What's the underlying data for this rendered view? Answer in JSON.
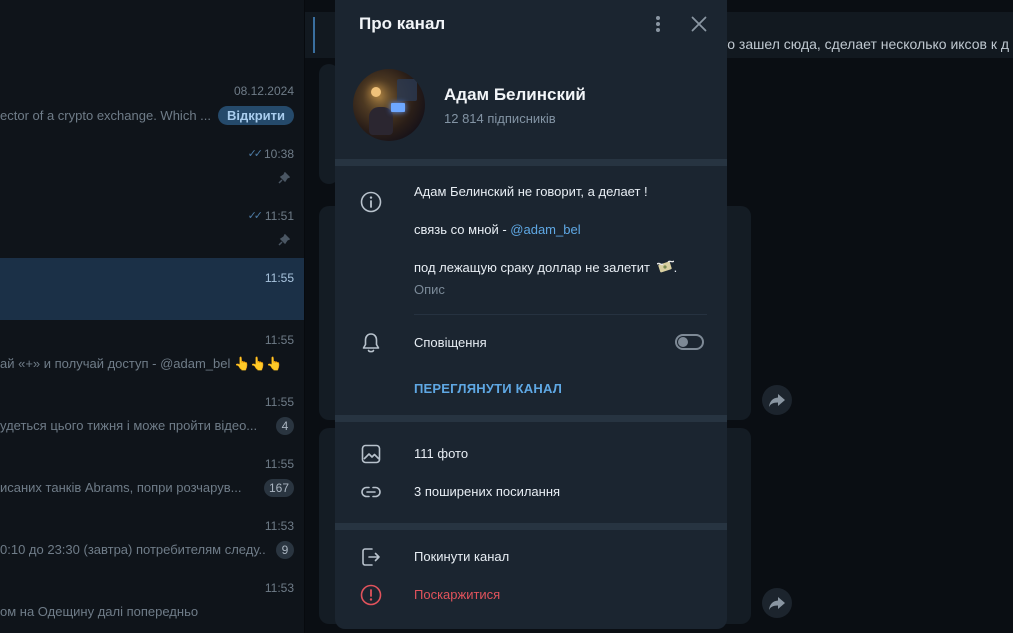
{
  "chat_list": {
    "rows": [
      {
        "time": "08.12.2024",
        "preview": "ector of a crypto exchange. Which ...",
        "action_pill": "Відкрити"
      },
      {
        "time": "10:38"
      },
      {
        "time": "11:51"
      },
      {
        "time": "11:55"
      },
      {
        "time": "11:55",
        "preview": "ай «+» и получай доступ - @adam_bel 👆👆👆"
      },
      {
        "time": "11:55",
        "preview": "удеться цього тижня і може пройти відео...",
        "badge": "4"
      },
      {
        "time": "11:55",
        "preview": "исаних танків Abrams, попри розчарув...",
        "badge": "167"
      },
      {
        "time": "11:53",
        "preview": "0:10 до 23:30 (завтра) потребителям следу...",
        "badge": "9"
      },
      {
        "time": "11:53",
        "preview": "ом на Одещину далі попередньо"
      }
    ]
  },
  "chat_area": {
    "pinned_text": ", кто зашел сюда, сделает несколько иксов к д"
  },
  "dialog": {
    "title": "Про канал",
    "channel_name": "Адам Белинский",
    "subscribers": "12 814 підписників",
    "description": {
      "line1": "Адам Белинский не говорит, а делает !",
      "line2_prefix": "связь со мной - ",
      "line2_link": "@adam_bel",
      "line3": "под лежащую сраку доллар не залетит",
      "line3_suffix": ".",
      "label": "Опис"
    },
    "notifications_label": "Сповіщення",
    "notifications_on": false,
    "view_channel_button": "ПЕРЕГЛЯНУТИ КАНАЛ",
    "media": {
      "photos": "111 фото",
      "links": "3 поширених посилання"
    },
    "leave_label": "Покинути канал",
    "report_label": "Поскаржитися"
  },
  "colors": {
    "dialog_bg": "#1b2530",
    "accent_link": "#5fa8e4",
    "danger": "#e2535c",
    "active_chat": "#1b3047"
  },
  "icons": [
    "more-vertical-icon",
    "close-icon",
    "info-icon",
    "bell-icon",
    "image-icon",
    "link-icon",
    "leave-icon",
    "report-icon",
    "double-check-icon",
    "pin-icon",
    "forward-icon",
    "money-emoji-icon"
  ]
}
